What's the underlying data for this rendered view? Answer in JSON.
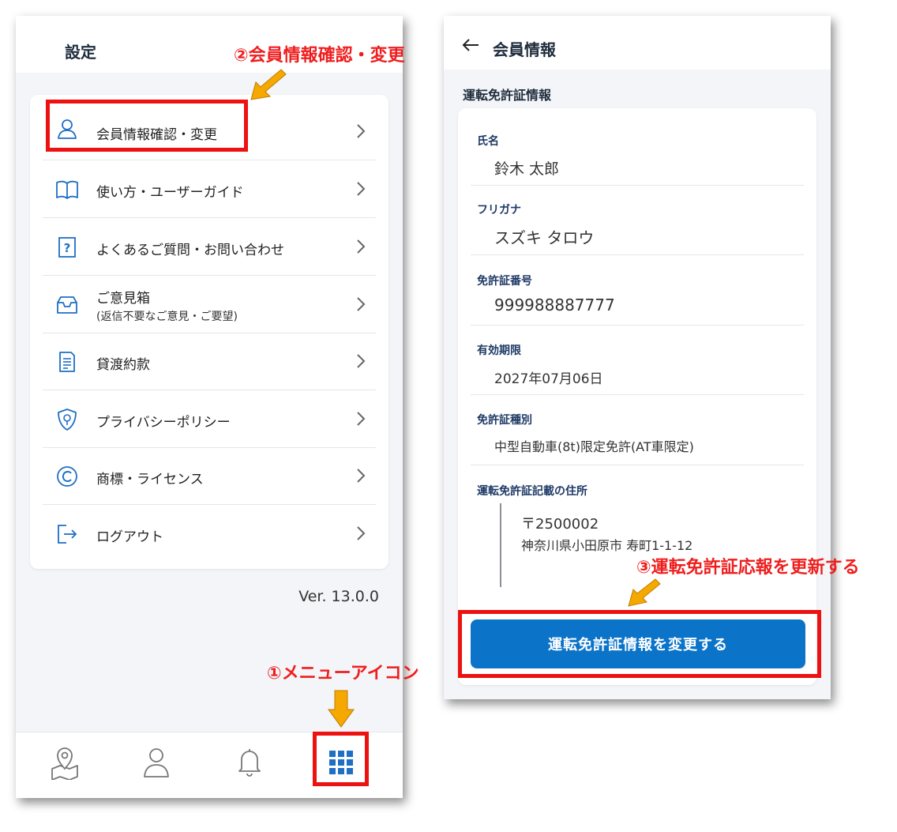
{
  "settings_screen": {
    "title": "設定",
    "menu_items": [
      {
        "label": "会員情報確認・変更",
        "icon": "user-icon"
      },
      {
        "label": "使い方・ユーザーガイド",
        "icon": "book-icon"
      },
      {
        "label": "よくあるご質問・お問い合わせ",
        "icon": "question-icon"
      },
      {
        "label": "ご意見箱",
        "sublabel": "(返信不要なご意見・ご要望)",
        "icon": "inbox-icon"
      },
      {
        "label": "貸渡約款",
        "icon": "document-icon"
      },
      {
        "label": "プライバシーポリシー",
        "icon": "shield-icon"
      },
      {
        "label": "商標・ライセンス",
        "icon": "copyright-icon"
      },
      {
        "label": "ログアウト",
        "icon": "logout-icon"
      }
    ],
    "version": "Ver. 13.0.0",
    "tabbar": [
      "map-pin-icon",
      "user-icon",
      "bell-icon",
      "grid-menu-icon"
    ]
  },
  "member_screen": {
    "title": "会員情報",
    "section_title": "運転免許証情報",
    "fields": [
      {
        "label": "氏名",
        "value": "鈴木 太郎"
      },
      {
        "label": "フリガナ",
        "value": "スズキ タロウ"
      },
      {
        "label": "免許証番号",
        "value": "999988887777"
      },
      {
        "label": "有効期限",
        "value": "2027年07月06日"
      },
      {
        "label": "免許証種別",
        "value": "中型自動車(8t)限定免許(AT車限定)"
      }
    ],
    "address": {
      "label": "運転免許証記載の住所",
      "zip": "〒2500002",
      "line": "神奈川県小田原市 寿町1-1-12"
    },
    "change_button": "運転免許証情報を変更する"
  },
  "annotations": {
    "step1": "①メニューアイコン",
    "step2": "②会員情報確認・変更",
    "step3": "③運転免許証応報を更新する",
    "highlight_color": "#ee1111",
    "arrow_color": "#f5a800"
  },
  "colors": {
    "primary_button": "#0b74c9",
    "icon_blue": "#1f6fc4",
    "background": "#f3f5f8"
  }
}
